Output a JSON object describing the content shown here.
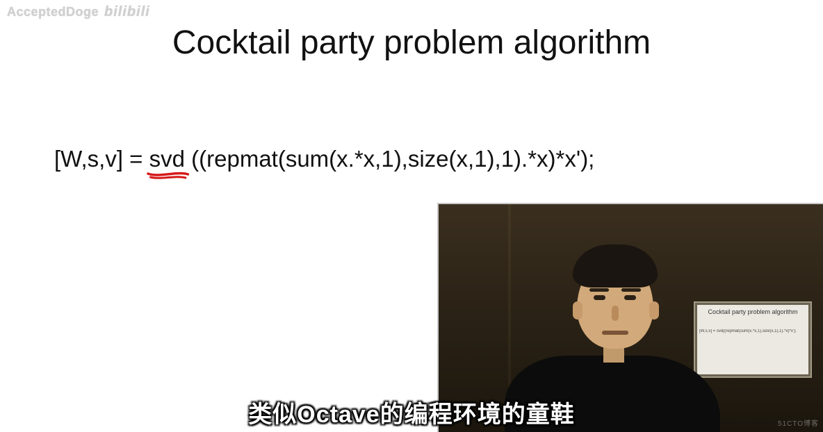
{
  "watermark": {
    "uploader": "AcceptedDoge",
    "site_logo": "bilibili"
  },
  "slide": {
    "title": "Cocktail party problem algorithm",
    "formula": {
      "pre": "[W,s,v] = ",
      "svd": "svd",
      "post": "((repmat(sum(x.*x,1),size(x,1),1).*x)*x');"
    },
    "annotation": {
      "underline_color": "#d61a1a",
      "underlined_token": "svd"
    }
  },
  "speaker_panel": {
    "mini_slide_title": "Cocktail party problem algorithm",
    "mini_slide_formula": "[W,s,v] = svd((repmat(sum(x.*x,1),size(x,1),1).*x)*x');"
  },
  "subtitle": "类似Octave的编程环境的童鞋",
  "corner_watermark": "51CTO博客"
}
